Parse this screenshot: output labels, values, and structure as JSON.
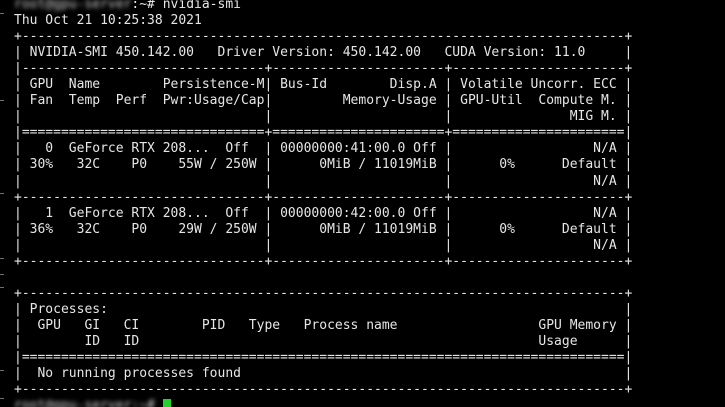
{
  "terminal": {
    "prompt_blurred": "root@gpu-server",
    "command": ":~# nvidia-smi",
    "timestamp": "Thu Oct 21 10:25:38 2021",
    "output_lines": [
      "+-----------------------------------------------------------------------------+",
      "| NVIDIA-SMI 450.142.00   Driver Version: 450.142.00   CUDA Version: 11.0     |",
      "|-------------------------------+----------------------+----------------------+",
      "| GPU  Name        Persistence-M| Bus-Id        Disp.A | Volatile Uncorr. ECC |",
      "| Fan  Temp  Perf  Pwr:Usage/Cap|         Memory-Usage | GPU-Util  Compute M. |",
      "|                               |                      |               MIG M. |",
      "|===============================+======================+======================|",
      "|   0  GeForce RTX 208...  Off  | 00000000:41:00.0 Off |                  N/A |",
      "| 30%   32C    P0    55W / 250W |      0MiB / 11019MiB |      0%      Default |",
      "|                               |                      |                  N/A |",
      "+-------------------------------+----------------------+----------------------+",
      "|   1  GeForce RTX 208...  Off  | 00000000:42:00.0 Off |                  N/A |",
      "| 36%   32C    P0    29W / 250W |      0MiB / 11019MiB |      0%      Default |",
      "|                               |                      |                  N/A |",
      "+-------------------------------+----------------------+----------------------+",
      "",
      "+-----------------------------------------------------------------------------+",
      "| Processes:                                                                  |",
      "|  GPU   GI   CI        PID   Type   Process name                  GPU Memory |",
      "|        ID   ID                                                   Usage      |",
      "|=============================================================================|",
      "|  No running processes found                                                 |",
      "+-----------------------------------------------------------------------------+"
    ],
    "next_prompt_blurred": "root@gpu-server:~#",
    "colors": {
      "background": "#000000",
      "text": "#e6e6e6",
      "cursor": "#22d32b"
    }
  }
}
